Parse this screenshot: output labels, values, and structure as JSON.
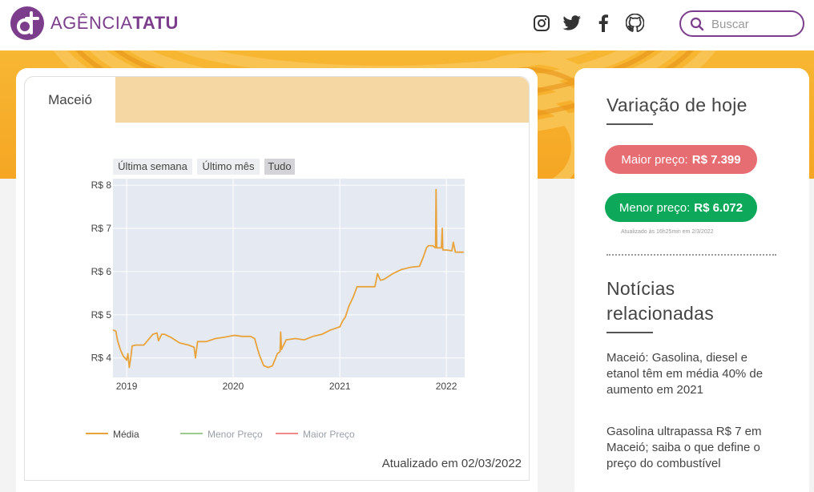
{
  "header": {
    "logo_light": "AGÊNCIA",
    "logo_bold": "TATU",
    "search_placeholder": "Buscar",
    "social_icons": [
      "instagram-icon",
      "twitter-icon",
      "facebook-icon",
      "github-icon"
    ],
    "brand_color": "#7c3e8c"
  },
  "card": {
    "tab_label": "Maceió",
    "updated_text": "Atualizado em 02/03/2022",
    "range_buttons": [
      "Última semana",
      "Último mês",
      "Tudo"
    ],
    "selected_range": "Tudo"
  },
  "chart_data": {
    "type": "line",
    "x_tick_labels": [
      "2019",
      "2020",
      "2021",
      "2022"
    ],
    "y_tick_labels": [
      "R$ 4",
      "R$ 5",
      "R$ 6",
      "R$ 7",
      "R$ 8"
    ],
    "ylim": [
      3.55,
      8.15
    ],
    "xlim": [
      "2018-11-15",
      "2022-03-05"
    ],
    "grid": true,
    "legend_position": "bottom",
    "series": [
      {
        "name": "Média",
        "color": "#e8a33c",
        "x": [
          "2018-11-15",
          "2018-11-25",
          "2018-12-01",
          "2018-12-10",
          "2018-12-20",
          "2019-01-01",
          "2019-01-05",
          "2019-01-10",
          "2019-01-15",
          "2019-01-20",
          "2019-02-01",
          "2019-03-01",
          "2019-04-01",
          "2019-04-15",
          "2019-04-20",
          "2019-05-01",
          "2019-05-10",
          "2019-06-01",
          "2019-06-15",
          "2019-07-01",
          "2019-08-01",
          "2019-08-20",
          "2019-08-25",
          "2019-09-01",
          "2019-10-01",
          "2019-11-01",
          "2019-12-01",
          "2020-01-01",
          "2020-01-10",
          "2020-02-01",
          "2020-03-01",
          "2020-03-15",
          "2020-03-25",
          "2020-04-01",
          "2020-04-15",
          "2020-05-01",
          "2020-05-15",
          "2020-06-01",
          "2020-06-10",
          "2020-06-12",
          "2020-06-15",
          "2020-07-01",
          "2020-08-01",
          "2020-09-01",
          "2020-10-01",
          "2020-11-01",
          "2020-12-01",
          "2021-01-01",
          "2021-01-10",
          "2021-01-20",
          "2021-02-01",
          "2021-02-15",
          "2021-03-01",
          "2021-04-01",
          "2021-05-01",
          "2021-05-10",
          "2021-05-20",
          "2021-06-01",
          "2021-07-01",
          "2021-08-01",
          "2021-09-01",
          "2021-10-01",
          "2021-10-15",
          "2021-10-25",
          "2021-11-01",
          "2021-11-15",
          "2021-11-25",
          "2021-11-27",
          "2021-11-29",
          "2021-12-15",
          "2021-12-18",
          "2021-12-20",
          "2022-01-01",
          "2022-01-20",
          "2022-01-25",
          "2022-02-01",
          "2022-02-15",
          "2022-03-02"
        ],
        "y": [
          4.65,
          4.62,
          4.4,
          4.2,
          4.05,
          3.95,
          4.1,
          3.78,
          4.0,
          4.28,
          4.3,
          4.3,
          4.55,
          4.58,
          4.4,
          4.55,
          4.55,
          4.48,
          4.42,
          4.35,
          4.3,
          4.25,
          4.0,
          4.38,
          4.38,
          4.45,
          4.48,
          4.52,
          4.52,
          4.5,
          4.5,
          4.45,
          4.2,
          4.05,
          3.82,
          3.78,
          3.82,
          4.1,
          4.15,
          4.6,
          4.2,
          4.42,
          4.45,
          4.42,
          4.5,
          4.55,
          4.65,
          4.72,
          4.85,
          4.95,
          5.2,
          5.4,
          5.65,
          5.65,
          5.65,
          5.95,
          5.8,
          5.82,
          5.95,
          6.05,
          6.1,
          6.12,
          6.35,
          6.55,
          6.6,
          6.6,
          6.55,
          7.9,
          6.55,
          6.55,
          7.0,
          6.5,
          6.5,
          6.48,
          6.68,
          6.45,
          6.45,
          6.45
        ]
      },
      {
        "name": "Menor Preço",
        "color": "#9ccb8f",
        "x": [],
        "y": []
      },
      {
        "name": "Maior Preço",
        "color": "#f08a8a",
        "x": [],
        "y": []
      }
    ]
  },
  "sidebar": {
    "title": "Variação de hoje",
    "max_label": "Maior preço:",
    "max_value": "R$ 7.399",
    "min_label": "Menor preço:",
    "min_value": "R$ 6.072",
    "updated_small": "Atualizado às 16h25min em 2/3/2022",
    "news_title_1": "Notícias",
    "news_title_2": "relacionadas",
    "news": [
      "Maceió: Gasolina, diesel e etanol têm em média 40% de aumento em 2021",
      "Gasolina ultrapassa R$ 7 em Maceió; saiba o que define o preço do combustível"
    ],
    "max_color": "#e66d72",
    "min_color": "#0da85a"
  }
}
